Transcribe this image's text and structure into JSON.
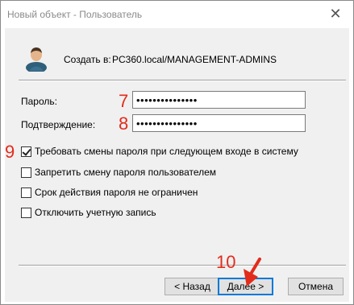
{
  "window": {
    "title": "Новый объект - Пользователь",
    "close_glyph": "✕"
  },
  "header": {
    "create_in_label": "Создать в:",
    "create_in_path": "PC360.local/MANAGEMENT-ADMINS"
  },
  "form": {
    "password_label": "Пароль:",
    "password_value": "•••••••••••••••",
    "confirm_label": "Подтверждение:",
    "confirm_value": "•••••••••••••••"
  },
  "options": [
    {
      "label": "Требовать смены пароля при следующем входе в систему",
      "checked": true
    },
    {
      "label": "Запретить смену пароля пользователем",
      "checked": false
    },
    {
      "label": "Срок действия пароля не ограничен",
      "checked": false
    },
    {
      "label": "Отключить учетную запись",
      "checked": false
    }
  ],
  "markers": {
    "password": "7",
    "confirm": "8",
    "require_change": "9",
    "next": "10"
  },
  "buttons": {
    "back": "< Назад",
    "next": "Далее >",
    "cancel": "Отмена"
  },
  "colors": {
    "marker": "#e32b1b",
    "default_button_border": "#0078d7"
  }
}
